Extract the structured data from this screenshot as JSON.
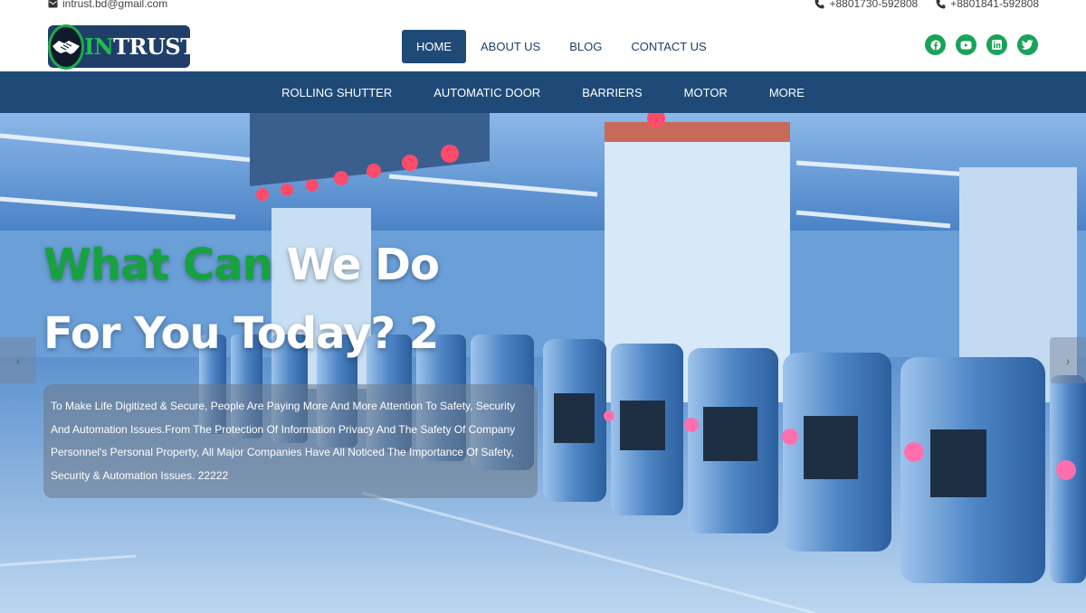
{
  "topbar": {
    "email": "intrust.bd@gmail.com",
    "phones": [
      "+8801730-592808",
      "+8801841-592808"
    ]
  },
  "logo": {
    "text_green": "IN",
    "text_white": "TRUST"
  },
  "nav": {
    "items": [
      {
        "label": "HOME",
        "active": true
      },
      {
        "label": "ABOUT US",
        "active": false
      },
      {
        "label": "BLOG",
        "active": false
      },
      {
        "label": "CONTACT US",
        "active": false
      }
    ]
  },
  "social": {
    "icons": [
      "facebook-icon",
      "youtube-icon",
      "linkedin-icon",
      "twitter-icon"
    ],
    "color": "#19a35a"
  },
  "subnav": {
    "items": [
      "ROLLING SHUTTER",
      "AUTOMATIC DOOR",
      "BARRIERS",
      "MOTOR",
      "MORE"
    ]
  },
  "hero": {
    "headline_green": "What Can",
    "headline_white_1": " We Do",
    "headline_white_2": "For You Today? 2",
    "description": "To Make Life Digitized & Secure, People Are Paying More And More Attention To Safety, Security And Automation Issues.From The Protection Of Information Privacy And The Safety Of Company Personnel's Personal Property, All Major Companies Have All Noticed The Importance Of Safety, Security & Automation Issues. 22222",
    "prev_label": "‹",
    "next_label": "›"
  },
  "colors": {
    "brand_blue": "#1f4a78",
    "brand_green": "#16a33f"
  }
}
